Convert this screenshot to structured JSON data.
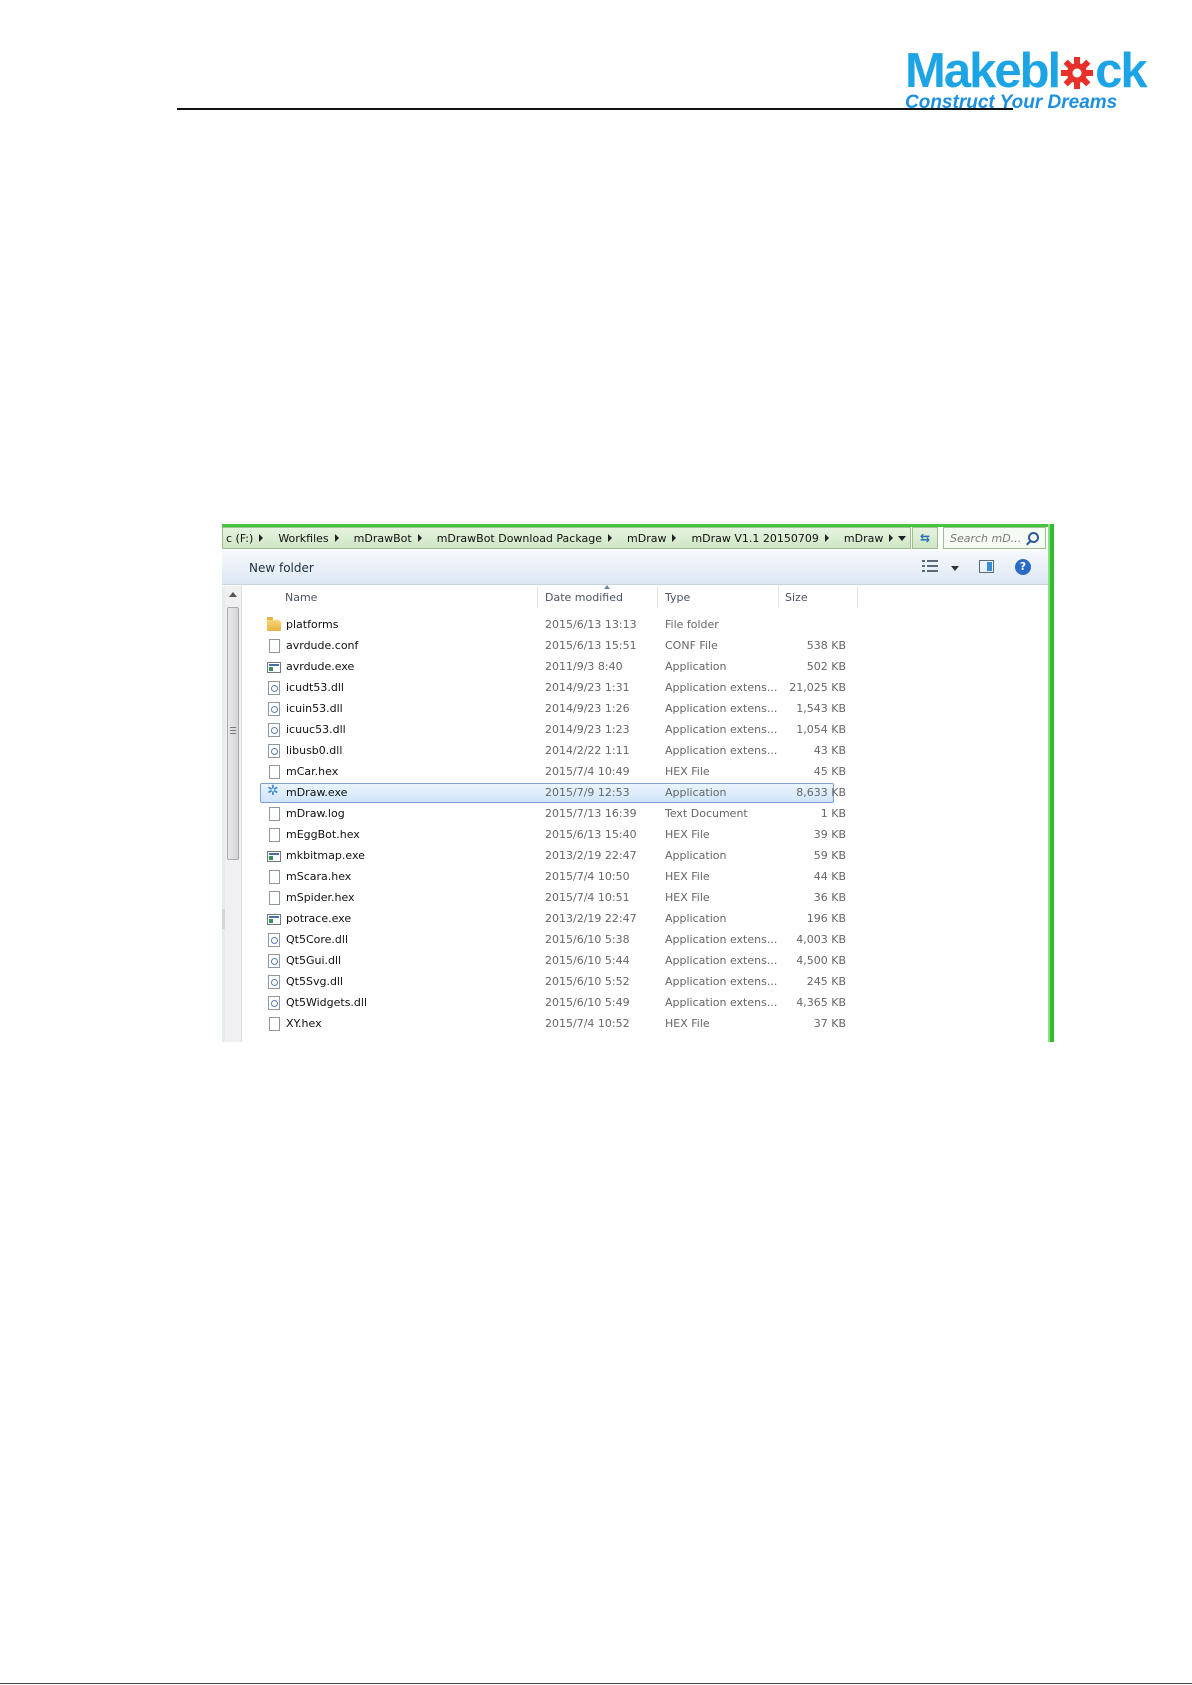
{
  "logo": {
    "word_left": "Makebl",
    "word_right": "ck",
    "tagline": "Construct Your Dreams",
    "colors": {
      "blue": "#1da4e4",
      "gear": "#e8302b"
    }
  },
  "explorer": {
    "breadcrumbs": [
      {
        "label": "c (F:)"
      },
      {
        "label": "Workfiles"
      },
      {
        "label": "mDrawBot"
      },
      {
        "label": "mDrawBot Download Package"
      },
      {
        "label": "mDraw"
      },
      {
        "label": "mDraw V1.1 20150709"
      },
      {
        "label": "mDraw"
      }
    ],
    "refresh_icon": "refresh-icon",
    "search_placeholder": "Search mD...",
    "toolbar": {
      "new_folder": "New folder",
      "help": "?"
    },
    "columns": {
      "name": "Name",
      "date": "Date modified",
      "type": "Type",
      "size": "Size"
    },
    "files": [
      {
        "icon": "folder",
        "name": "platforms",
        "date": "2015/6/13 13:13",
        "type": "File folder",
        "size": ""
      },
      {
        "icon": "file",
        "name": "avrdude.conf",
        "date": "2015/6/13 15:51",
        "type": "CONF File",
        "size": "538 KB"
      },
      {
        "icon": "exe",
        "name": "avrdude.exe",
        "date": "2011/9/3 8:40",
        "type": "Application",
        "size": "502 KB"
      },
      {
        "icon": "dll",
        "name": "icudt53.dll",
        "date": "2014/9/23 1:31",
        "type": "Application extens...",
        "size": "21,025 KB"
      },
      {
        "icon": "dll",
        "name": "icuin53.dll",
        "date": "2014/9/23 1:26",
        "type": "Application extens...",
        "size": "1,543 KB"
      },
      {
        "icon": "dll",
        "name": "icuuc53.dll",
        "date": "2014/9/23 1:23",
        "type": "Application extens...",
        "size": "1,054 KB"
      },
      {
        "icon": "dll",
        "name": "libusb0.dll",
        "date": "2014/2/22 1:11",
        "type": "Application extens...",
        "size": "43 KB"
      },
      {
        "icon": "file",
        "name": "mCar.hex",
        "date": "2015/7/4 10:49",
        "type": "HEX File",
        "size": "45 KB"
      },
      {
        "icon": "app",
        "name": "mDraw.exe",
        "date": "2015/7/9 12:53",
        "type": "Application",
        "size": "8,633 KB",
        "selected": true
      },
      {
        "icon": "file",
        "name": "mDraw.log",
        "date": "2015/7/13 16:39",
        "type": "Text Document",
        "size": "1 KB"
      },
      {
        "icon": "file",
        "name": "mEggBot.hex",
        "date": "2015/6/13 15:40",
        "type": "HEX File",
        "size": "39 KB"
      },
      {
        "icon": "exe",
        "name": "mkbitmap.exe",
        "date": "2013/2/19 22:47",
        "type": "Application",
        "size": "59 KB"
      },
      {
        "icon": "file",
        "name": "mScara.hex",
        "date": "2015/7/4 10:50",
        "type": "HEX File",
        "size": "44 KB"
      },
      {
        "icon": "file",
        "name": "mSpider.hex",
        "date": "2015/7/4 10:51",
        "type": "HEX File",
        "size": "36 KB"
      },
      {
        "icon": "exe",
        "name": "potrace.exe",
        "date": "2013/2/19 22:47",
        "type": "Application",
        "size": "196 KB"
      },
      {
        "icon": "dll",
        "name": "Qt5Core.dll",
        "date": "2015/6/10 5:38",
        "type": "Application extens...",
        "size": "4,003 KB"
      },
      {
        "icon": "dll",
        "name": "Qt5Gui.dll",
        "date": "2015/6/10 5:44",
        "type": "Application extens...",
        "size": "4,500 KB"
      },
      {
        "icon": "dll",
        "name": "Qt5Svg.dll",
        "date": "2015/6/10 5:52",
        "type": "Application extens...",
        "size": "245 KB"
      },
      {
        "icon": "dll",
        "name": "Qt5Widgets.dll",
        "date": "2015/6/10 5:49",
        "type": "Application extens...",
        "size": "4,365 KB"
      },
      {
        "icon": "file",
        "name": "XY.hex",
        "date": "2015/7/4 10:52",
        "type": "HEX File",
        "size": "37 KB"
      }
    ]
  }
}
